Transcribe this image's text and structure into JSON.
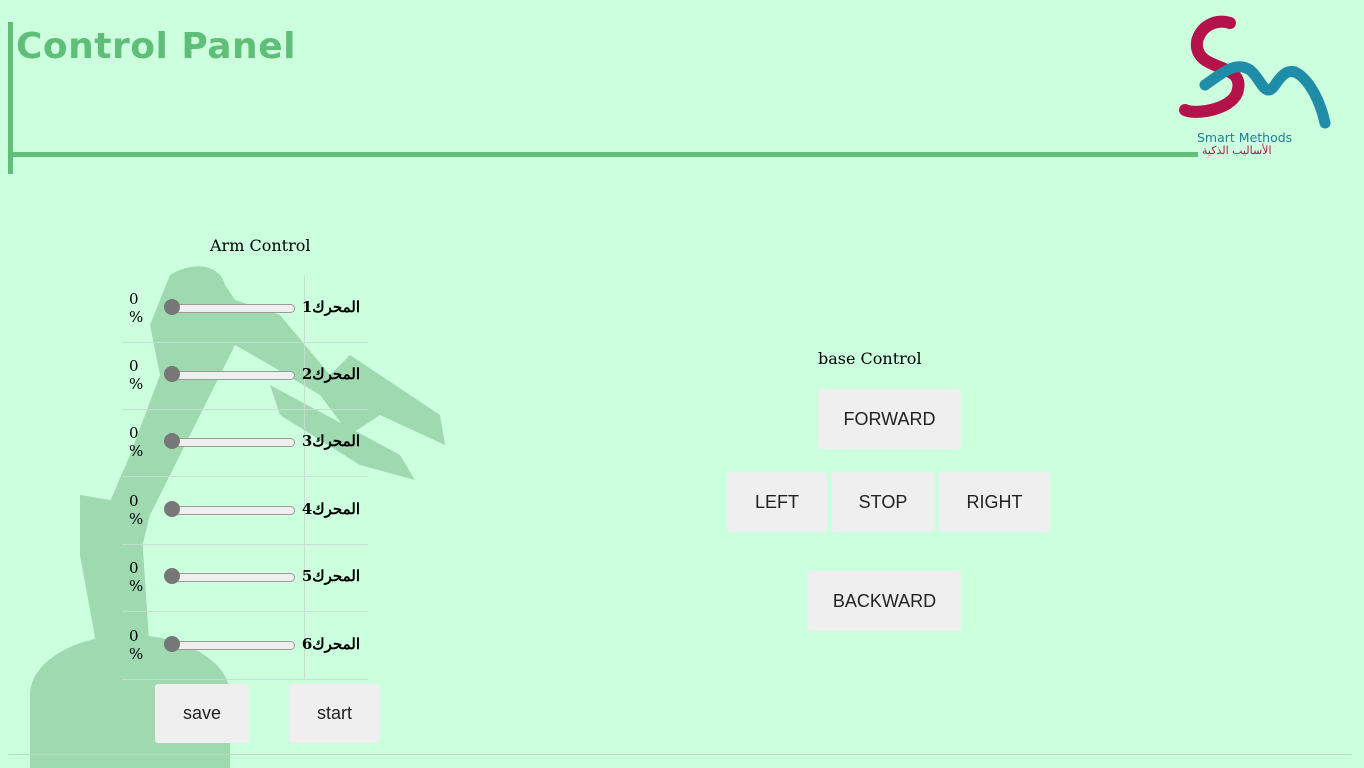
{
  "header": {
    "title": "Control Panel"
  },
  "logo": {
    "text_en": "Smart Methods",
    "text_ar": "الأساليب الذكية"
  },
  "arm_control": {
    "title": "Arm Control",
    "motors": [
      {
        "label": "المحرك1",
        "value": "0",
        "unit": "%",
        "level": 0
      },
      {
        "label": "المحرك2",
        "value": "0",
        "unit": "%",
        "level": 0
      },
      {
        "label": "المحرك3",
        "value": "0",
        "unit": "%",
        "level": 0
      },
      {
        "label": "المحرك4",
        "value": "0",
        "unit": "%",
        "level": 0
      },
      {
        "label": "المحرك5",
        "value": "0",
        "unit": "%",
        "level": 0
      },
      {
        "label": "المحرك6",
        "value": "0",
        "unit": "%",
        "level": 0
      }
    ],
    "save_label": "save",
    "start_label": "start"
  },
  "base_control": {
    "title": "base Control",
    "forward": "FORWARD",
    "left": "LEFT",
    "stop": "STOP",
    "right": "RIGHT",
    "backward": "BACKWARD"
  },
  "colors": {
    "background": "#ccffdd",
    "accent": "#5fbf78",
    "button": "#efefef"
  }
}
